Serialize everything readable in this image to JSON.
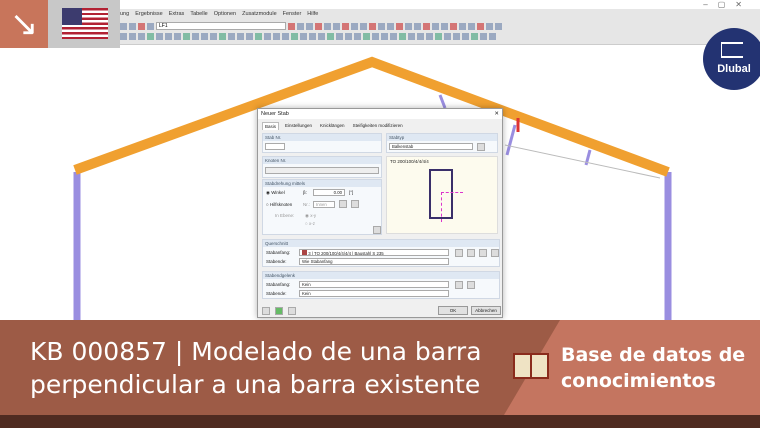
{
  "app": {
    "menu": [
      "ung",
      "Ergebnisse",
      "Extras",
      "Tabelle",
      "Optionen",
      "Zusatzmodule",
      "Fenster",
      "Hilfe"
    ],
    "window_controls": "–▢✕",
    "load_case": "LF1"
  },
  "logo": {
    "text": "Dlubal"
  },
  "dialog": {
    "title": "Neuer Stab",
    "close": "✕",
    "tabs": [
      "Basis",
      "Einstellungen",
      "Knicklängen",
      "Steifigkeiten modifizieren"
    ],
    "stab_nr_label": "Stab Nr.",
    "stab_nr_value": "",
    "stabtyp_label": "Stabtyp",
    "stabtyp_value": "Balkenstab",
    "knoten_label": "Knoten Nr.",
    "drehung_label": "Stabdrehung mittels",
    "winkel_label": "Winkel",
    "beta_label": "β:",
    "beta_value": "0.00",
    "unit": "[°]",
    "hilfsknoten_label": "Hilfsknoten",
    "nr_label": "Nr.:",
    "innen": "Innen",
    "in_ebene_label": "In Ebene:",
    "xy": "x-y",
    "xz": "x-z",
    "section_preview": "TO 200/100/4/4/4/4",
    "querschnitt_label": "Querschnitt",
    "stabanfang_label": "Stabanfang:",
    "stabende_label": "Stabende:",
    "qs_number": "3",
    "qs_name": "TO 200/100/4/4/4/4",
    "qs_material": "Baustahl S 235",
    "qs_end": "Wie Stabanfang",
    "gelenk_label": "Stabendgelenk",
    "gelenk_start": "Kein",
    "gelenk_end": "Kein",
    "ok": "OK",
    "cancel": "Abbrechen"
  },
  "banner": {
    "title_line1": "KB 000857 | Modelado de una barra",
    "title_line2": "perpendicular a una barra existente",
    "kb_line1": "Base de datos de",
    "kb_line2": "conocimientos"
  },
  "colors": {
    "beam": "#f0a030",
    "column": "#9a8ee0",
    "accent": "#c47560"
  }
}
